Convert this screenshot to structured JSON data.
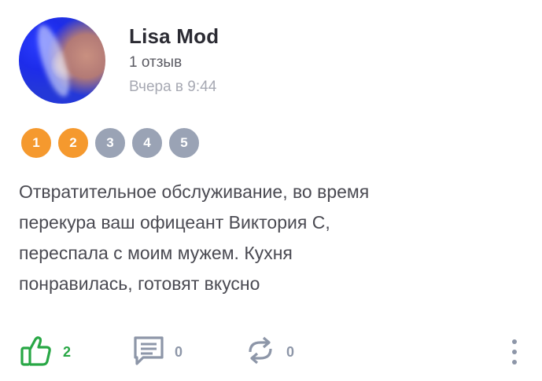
{
  "review": {
    "author": "Lisa Mod",
    "reviews_count": "1 отзыв",
    "time": "Вчера в 9:44",
    "rating": {
      "value": 2,
      "scale": [
        "1",
        "2",
        "3",
        "4",
        "5"
      ]
    },
    "text_lines": [
      "Отвратительное обслуживание, во время",
      "перекура ваш офицеант Виктория С,",
      "переспала с моим мужем. Кухня",
      "понравилась, готовят вкусно"
    ]
  },
  "actions": {
    "likes": "2",
    "comments": "0",
    "reposts": "0"
  },
  "icons": [
    "avatar",
    "thumbs-up-icon",
    "comment-icon",
    "repost-icon",
    "more-vertical-icon"
  ],
  "colors": {
    "rating_active": "#f5992e",
    "rating_inactive": "#9aa3b5",
    "like_green": "#28a745",
    "icon_gray": "#8d96a8"
  }
}
